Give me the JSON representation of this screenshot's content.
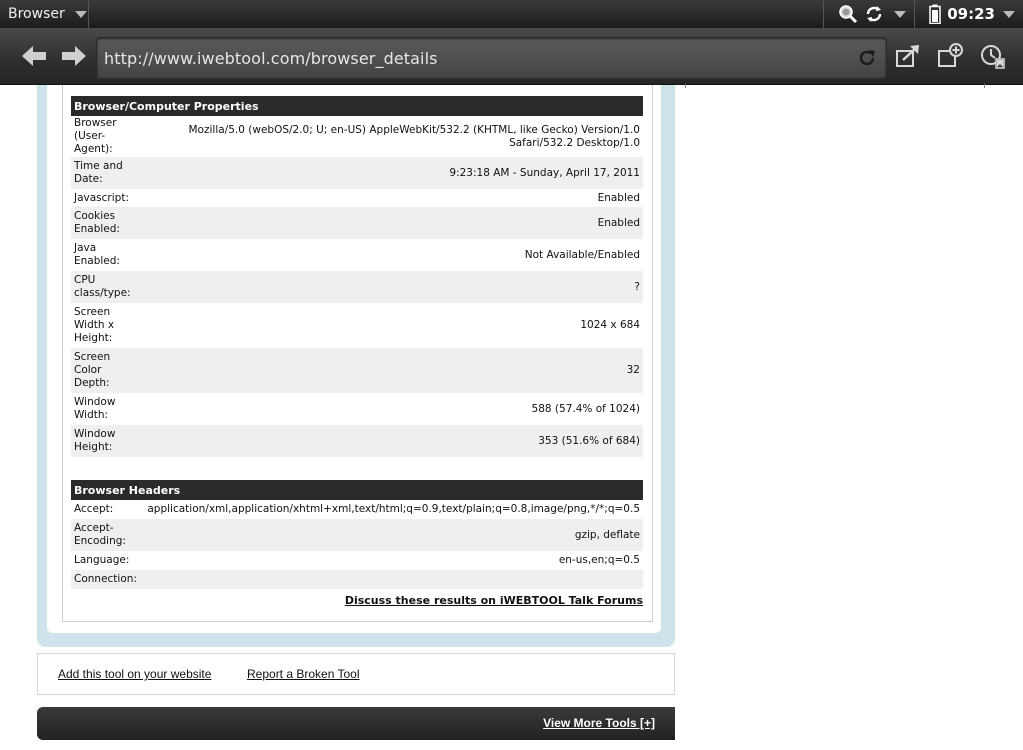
{
  "status_bar": {
    "app_name": "Browser",
    "time": "09:23"
  },
  "toolbar": {
    "url": "http://www.iwebtool.com/browser_details"
  },
  "properties": {
    "heading": "Browser/Computer Properties",
    "rows": [
      {
        "key": "Browser (User-Agent):",
        "value_line1": "Mozilla/5.0 (webOS/2.0; U; en-US) AppleWebKit/532.2 (KHTML, like Gecko) Version/1.0",
        "value_line2": "Safari/532.2 Desktop/1.0"
      },
      {
        "key": "Time and Date:",
        "value": "9:23:18 AM - Sunday, April 17, 2011"
      },
      {
        "key": "Javascript:",
        "value": "Enabled"
      },
      {
        "key": "Cookies Enabled:",
        "value": "Enabled"
      },
      {
        "key": "Java Enabled:",
        "value": "Not Available/Enabled"
      },
      {
        "key": "CPU class/type:",
        "value": "?"
      },
      {
        "key": "Screen Width x Height:",
        "value": "1024 x 684"
      },
      {
        "key": "Screen Color Depth:",
        "value": "32"
      },
      {
        "key": "Window Width:",
        "value": "588 (57.4% of 1024)"
      },
      {
        "key": "Window Height:",
        "value": "353 (51.6% of 684)"
      }
    ]
  },
  "headers": {
    "heading": "Browser Headers",
    "rows": [
      {
        "key": "Accept:",
        "value": "application/xml,application/xhtml+xml,text/html;q=0.9,text/plain;q=0.8,image/png,*/*;q=0.5"
      },
      {
        "key": "Accept-Encoding:",
        "value": "gzip, deflate"
      },
      {
        "key": "Language:",
        "value": "en-us,en;q=0.5"
      },
      {
        "key": "Connection:",
        "value": ""
      }
    ]
  },
  "forum_link": "Discuss these results on iWEBTOOL Talk Forums",
  "footer_links": {
    "add_tool": "Add this tool on your website",
    "report": "Report a Broken Tool"
  },
  "more_tools": "View More Tools [+]"
}
